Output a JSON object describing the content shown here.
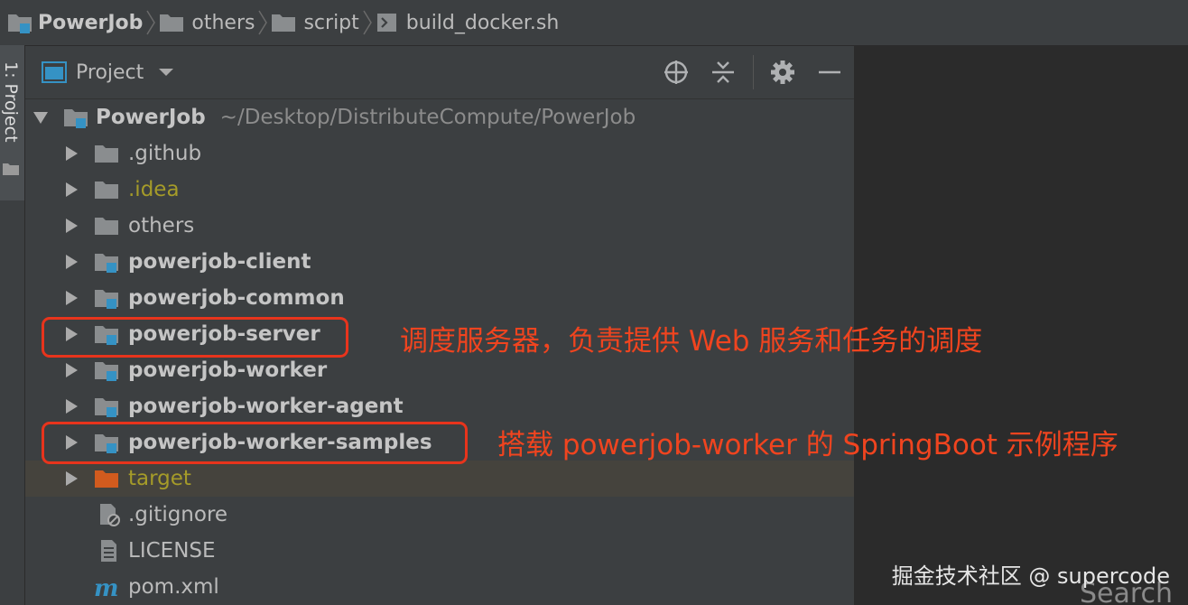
{
  "breadcrumb": {
    "items": [
      "PowerJob",
      "others",
      "script",
      "build_docker.sh"
    ]
  },
  "tool_window": {
    "strip_label": "1: Project"
  },
  "panel": {
    "title": "Project"
  },
  "tree": {
    "root": {
      "name": "PowerJob",
      "path": "~/Desktop/DistributeCompute/PowerJob"
    },
    "items": [
      {
        "label": ".github"
      },
      {
        "label": ".idea"
      },
      {
        "label": "others"
      },
      {
        "label": "powerjob-client"
      },
      {
        "label": "powerjob-common"
      },
      {
        "label": "powerjob-server"
      },
      {
        "label": "powerjob-worker"
      },
      {
        "label": "powerjob-worker-agent"
      },
      {
        "label": "powerjob-worker-samples"
      },
      {
        "label": "target"
      },
      {
        "label": ".gitignore"
      },
      {
        "label": "LICENSE"
      },
      {
        "label": "pom.xml"
      }
    ]
  },
  "annotations": {
    "server_note": "调度服务器，负责提供 Web 服务和任务的调度",
    "samples_note": "搭载 powerjob-worker 的 SpringBoot 示例程序"
  },
  "overlay": {
    "watermark": "掘金技术社区 @ supercode",
    "search_hint": "Search"
  },
  "colors": {
    "panel_bg": "#3c3f41",
    "editor_bg": "#2b2b2b",
    "module_badge": "#3592c4",
    "annotation_red": "#e8341c",
    "excluded_orange": "#d25b1e",
    "ignored_text": "#a59b29"
  },
  "icons": {
    "breadcrumb_root": "module-folder-icon",
    "breadcrumb_folder": "folder-icon",
    "breadcrumb_file": "shell-script-icon",
    "tools": [
      "locate-icon",
      "collapse-all-icon",
      "gear-icon",
      "minimize-icon"
    ],
    "file_gitignore": "gitignore-file-icon",
    "file_license": "text-file-icon",
    "file_pom": "maven-icon"
  }
}
